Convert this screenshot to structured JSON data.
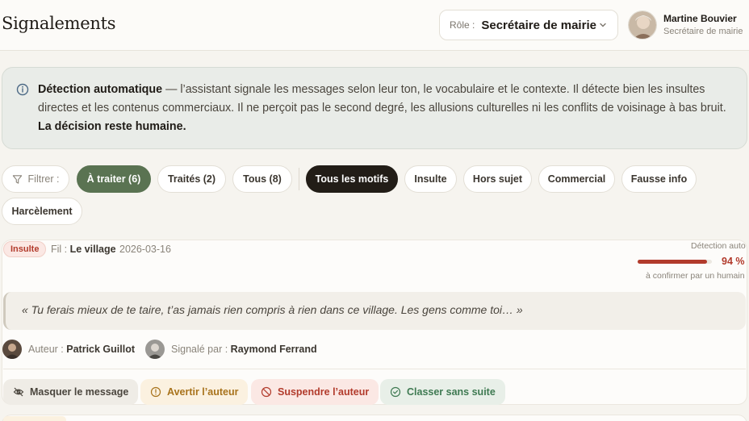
{
  "header": {
    "title": "Signalements",
    "role_label": "Rôle :",
    "role_value": "Secrétaire de mairie",
    "user_name": "Martine Bouvier",
    "user_role": "Secrétaire de mairie"
  },
  "info": {
    "strong_start": "Détection automatique",
    "body": " — l’assistant signale les messages selon leur ton, le vocabulaire et le contexte. Il détecte bien les insultes directes et les contenus commerciaux. Il ne perçoit pas le second degré, les allusions culturelles ni les conflits de voisinage à bas bruit. ",
    "strong_end": "La décision reste humaine."
  },
  "filters": {
    "label": "Filtrer :",
    "status": [
      {
        "label": "À traiter (6)",
        "active": true
      },
      {
        "label": "Traités (2)",
        "active": false
      },
      {
        "label": "Tous (8)",
        "active": false
      }
    ],
    "reasons": [
      {
        "label": "Tous les motifs",
        "active": true
      },
      {
        "label": "Insulte",
        "active": false
      },
      {
        "label": "Hors sujet",
        "active": false
      },
      {
        "label": "Commercial",
        "active": false
      },
      {
        "label": "Fausse info",
        "active": false
      },
      {
        "label": "Harcèlement",
        "active": false
      }
    ]
  },
  "report": {
    "badge": "Insulte",
    "thread_label": "Fil :",
    "thread_name": "Le village",
    "date": "2026-03-16",
    "detection_label": "Détection auto",
    "detection_score": 0.94,
    "detection_pct_text": "94 %",
    "detection_note": "à confirmer par un humain",
    "quote": "« Tu ferais mieux de te taire, t’as jamais rien compris à rien dans ce village. Les gens comme toi… »",
    "author_label": "Auteur :",
    "author_name": "Patrick Guillot",
    "reporter_label": "Signalé par :",
    "reporter_name": "Raymond Ferrand",
    "actions": {
      "mask": "Masquer le message",
      "warn": "Avertir l’auteur",
      "suspend": "Suspendre l’auteur",
      "close": "Classer sans suite"
    }
  },
  "colors": {
    "accent_green": "#5a7352",
    "danger": "#b23b2c",
    "warning": "#a8731c",
    "success": "#3f7a52"
  }
}
